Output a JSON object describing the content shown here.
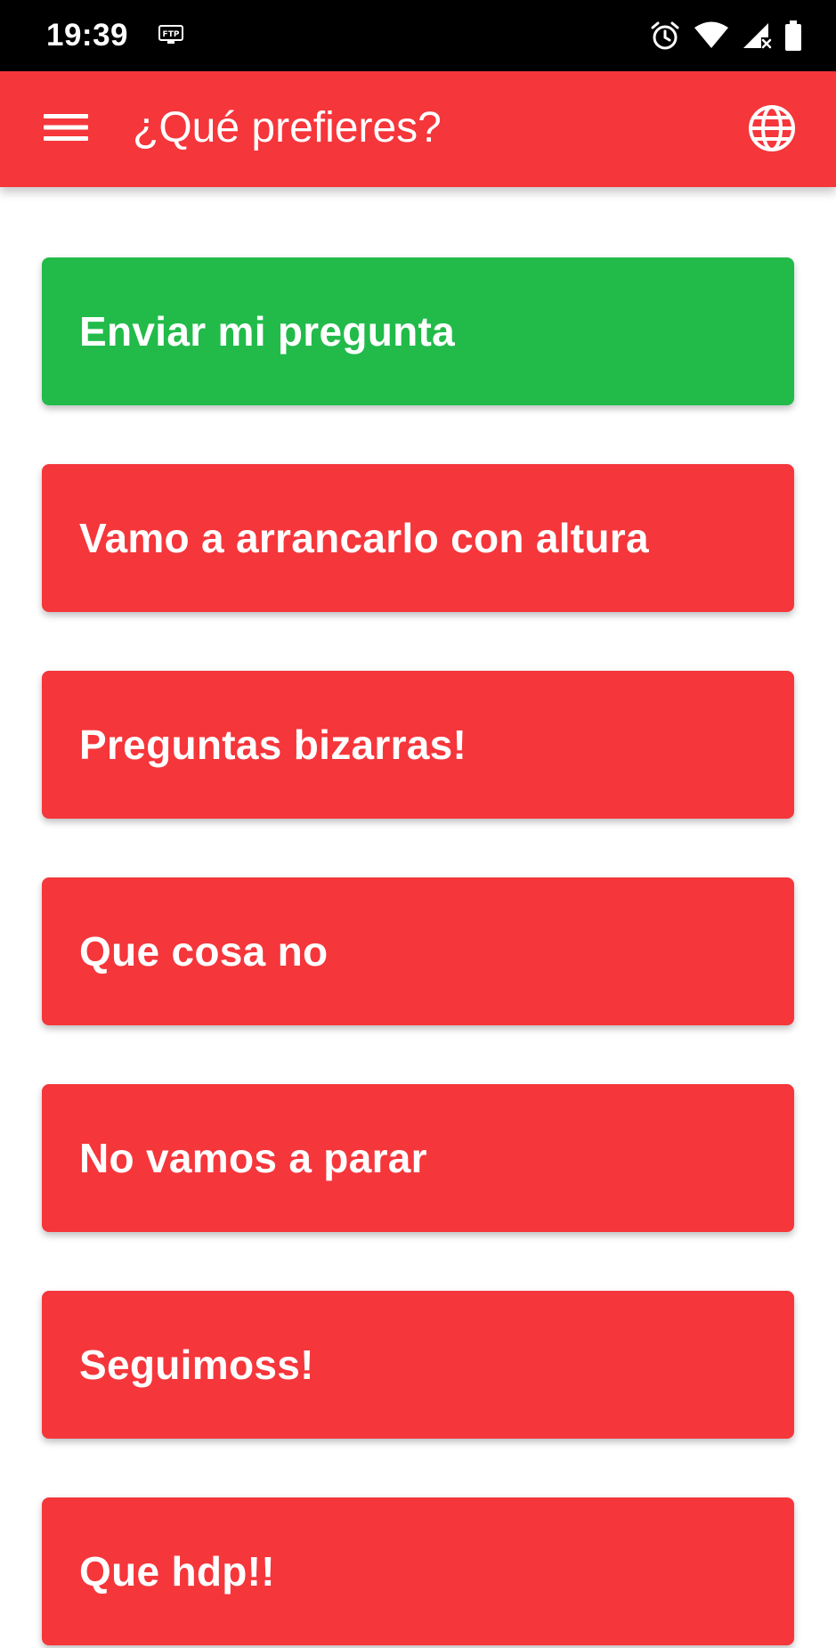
{
  "status_bar": {
    "time": "19:39",
    "icons": [
      "ftp-icon",
      "alarm-icon",
      "wifi-icon",
      "cellular-signal-icon",
      "battery-icon"
    ]
  },
  "app_bar": {
    "menu_icon": "hamburger-menu-icon",
    "title": "¿Qué prefieres?",
    "language_icon": "globe-icon"
  },
  "categories": [
    {
      "label": "Enviar mi pregunta",
      "color": "#22bb4a"
    },
    {
      "label": "Vamo a arrancarlo con altura",
      "color": "#f5363b"
    },
    {
      "label": "Preguntas bizarras!",
      "color": "#f5363b"
    },
    {
      "label": "Que cosa no",
      "color": "#f5363b"
    },
    {
      "label": "No vamos a parar",
      "color": "#f5363b"
    },
    {
      "label": "Seguimoss!",
      "color": "#f5363b"
    },
    {
      "label": "Que hdp!!",
      "color": "#f5363b"
    }
  ],
  "colors": {
    "app_bar": "#f5363b",
    "primary_button": "#22bb4a",
    "category_button": "#f5363b",
    "status_bar": "#000000"
  }
}
